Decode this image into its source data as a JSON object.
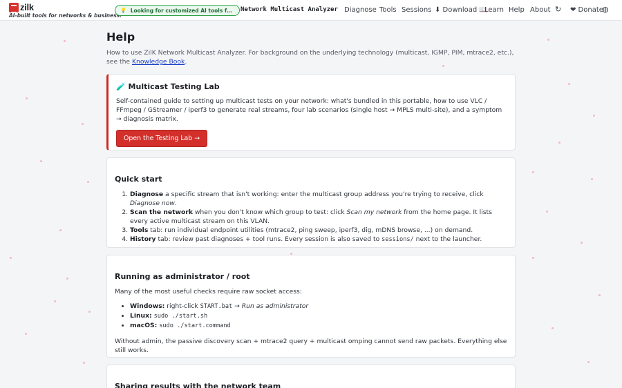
{
  "brand": {
    "logo_word": "zilk",
    "tagline": "AI-built tools for networks & business."
  },
  "promo": {
    "icon": "lightbulb-icon",
    "text": "Looking for customized AI tools for y…"
  },
  "app_title": "Network Multicast Analyzer",
  "nav": {
    "diagnose": "Diagnose",
    "tools": "Tools",
    "sessions": "Sessions",
    "download": "⬇ Download",
    "learn": "Learn",
    "help": "Help",
    "about": "About",
    "donate": "❤ Donate"
  },
  "page": {
    "title": "Help",
    "intro_before": "How to use ZilK Network Multicast Analyzer. For background on the underlying technology (multicast, IGMP, PIM, mtrace2, etc.), see the",
    "intro_link": "Knowledge Book",
    "intro_after": "."
  },
  "lab": {
    "title": "Multicast Testing Lab",
    "text": "Self-contained guide to setting up multicast tests on your network: what's bundled in this portable, how to use VLC / FFmpeg / GStreamer / iperf3 to generate real streams, four lab scenarios (single host → MPLS multi-site), and a symptom → diagnosis matrix.",
    "button": "Open the Testing Lab →"
  },
  "quickstart": {
    "title": "Quick start",
    "items": [
      {
        "b": "Diagnose",
        "t1": " a specific stream that isn't working: enter the multicast group address you're trying to receive, click ",
        "i": "Diagnose now",
        "t2": "."
      },
      {
        "b": "Scan the network",
        "t1": " when you don't know which group to test: click ",
        "i": "Scan my network",
        "t2": " from the home page. It lists every active multicast stream on this VLAN."
      },
      {
        "b": "Tools",
        "t1": " tab: run individual endpoint utilities (mtrace2, ping sweep, iperf3, dig, mDNS browse, ...) on demand.",
        "i": "",
        "t2": ""
      },
      {
        "b": "History",
        "t1": " tab: review past diagnoses + tool runs. Every session is also saved to ",
        "code": "sessions/",
        "t2": " next to the launcher."
      }
    ]
  },
  "admin": {
    "title": "Running as administrator / root",
    "lead": "Many of the most useful checks require raw socket access:",
    "items": [
      {
        "os": "Windows:",
        "t1": " right-click ",
        "code": "START.bat",
        "t2": " → ",
        "i": "Run as administrator"
      },
      {
        "os": "Linux:",
        "t1": " ",
        "code": "sudo ./start.sh",
        "t2": "",
        "i": ""
      },
      {
        "os": "macOS:",
        "t1": " ",
        "code": "sudo ./start.command",
        "t2": "",
        "i": ""
      }
    ],
    "footer": "Without admin, the passive discovery scan + mtrace2 query + multicast omping cannot send raw packets. Everything else still works."
  },
  "sharing": {
    "title": "Sharing results with the network team"
  },
  "colors": {
    "accent": "#d3302c",
    "promo_border": "#2fa34a",
    "link": "#1a3fc4"
  }
}
